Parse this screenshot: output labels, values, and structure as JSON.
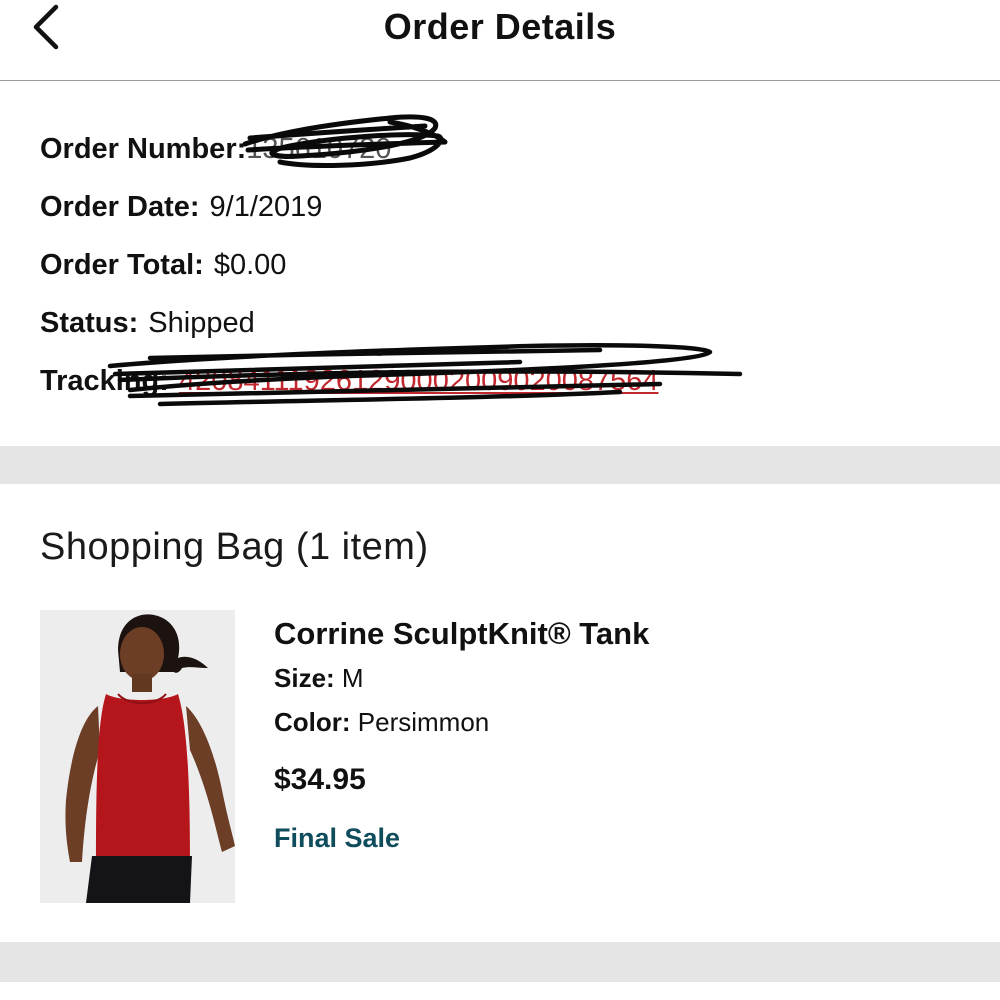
{
  "header": {
    "title": "Order Details",
    "back_icon": "chevron-left-icon"
  },
  "order": {
    "number_label": "Order Number:",
    "number_value": "135610720",
    "date_label": "Order Date:",
    "date_value": "9/1/2019",
    "total_label": "Order Total:",
    "total_value": "$0.00",
    "status_label": "Status:",
    "status_value": "Shipped",
    "tracking_label": "Tracking:",
    "tracking_value": "420841119261290002009020087564"
  },
  "bag": {
    "title": "Shopping Bag (1 item)",
    "items": [
      {
        "name": "Corrine SculptKnit® Tank",
        "size_label": "Size:",
        "size_value": "M",
        "color_label": "Color:",
        "color_value": "Persimmon",
        "price": "$34.95",
        "final_sale": "Final Sale"
      }
    ]
  },
  "colors": {
    "tracking_link": "#c1272d",
    "final_sale": "#0f4c5c",
    "separator": "#e5e5e5",
    "tank": "#b5161c"
  }
}
